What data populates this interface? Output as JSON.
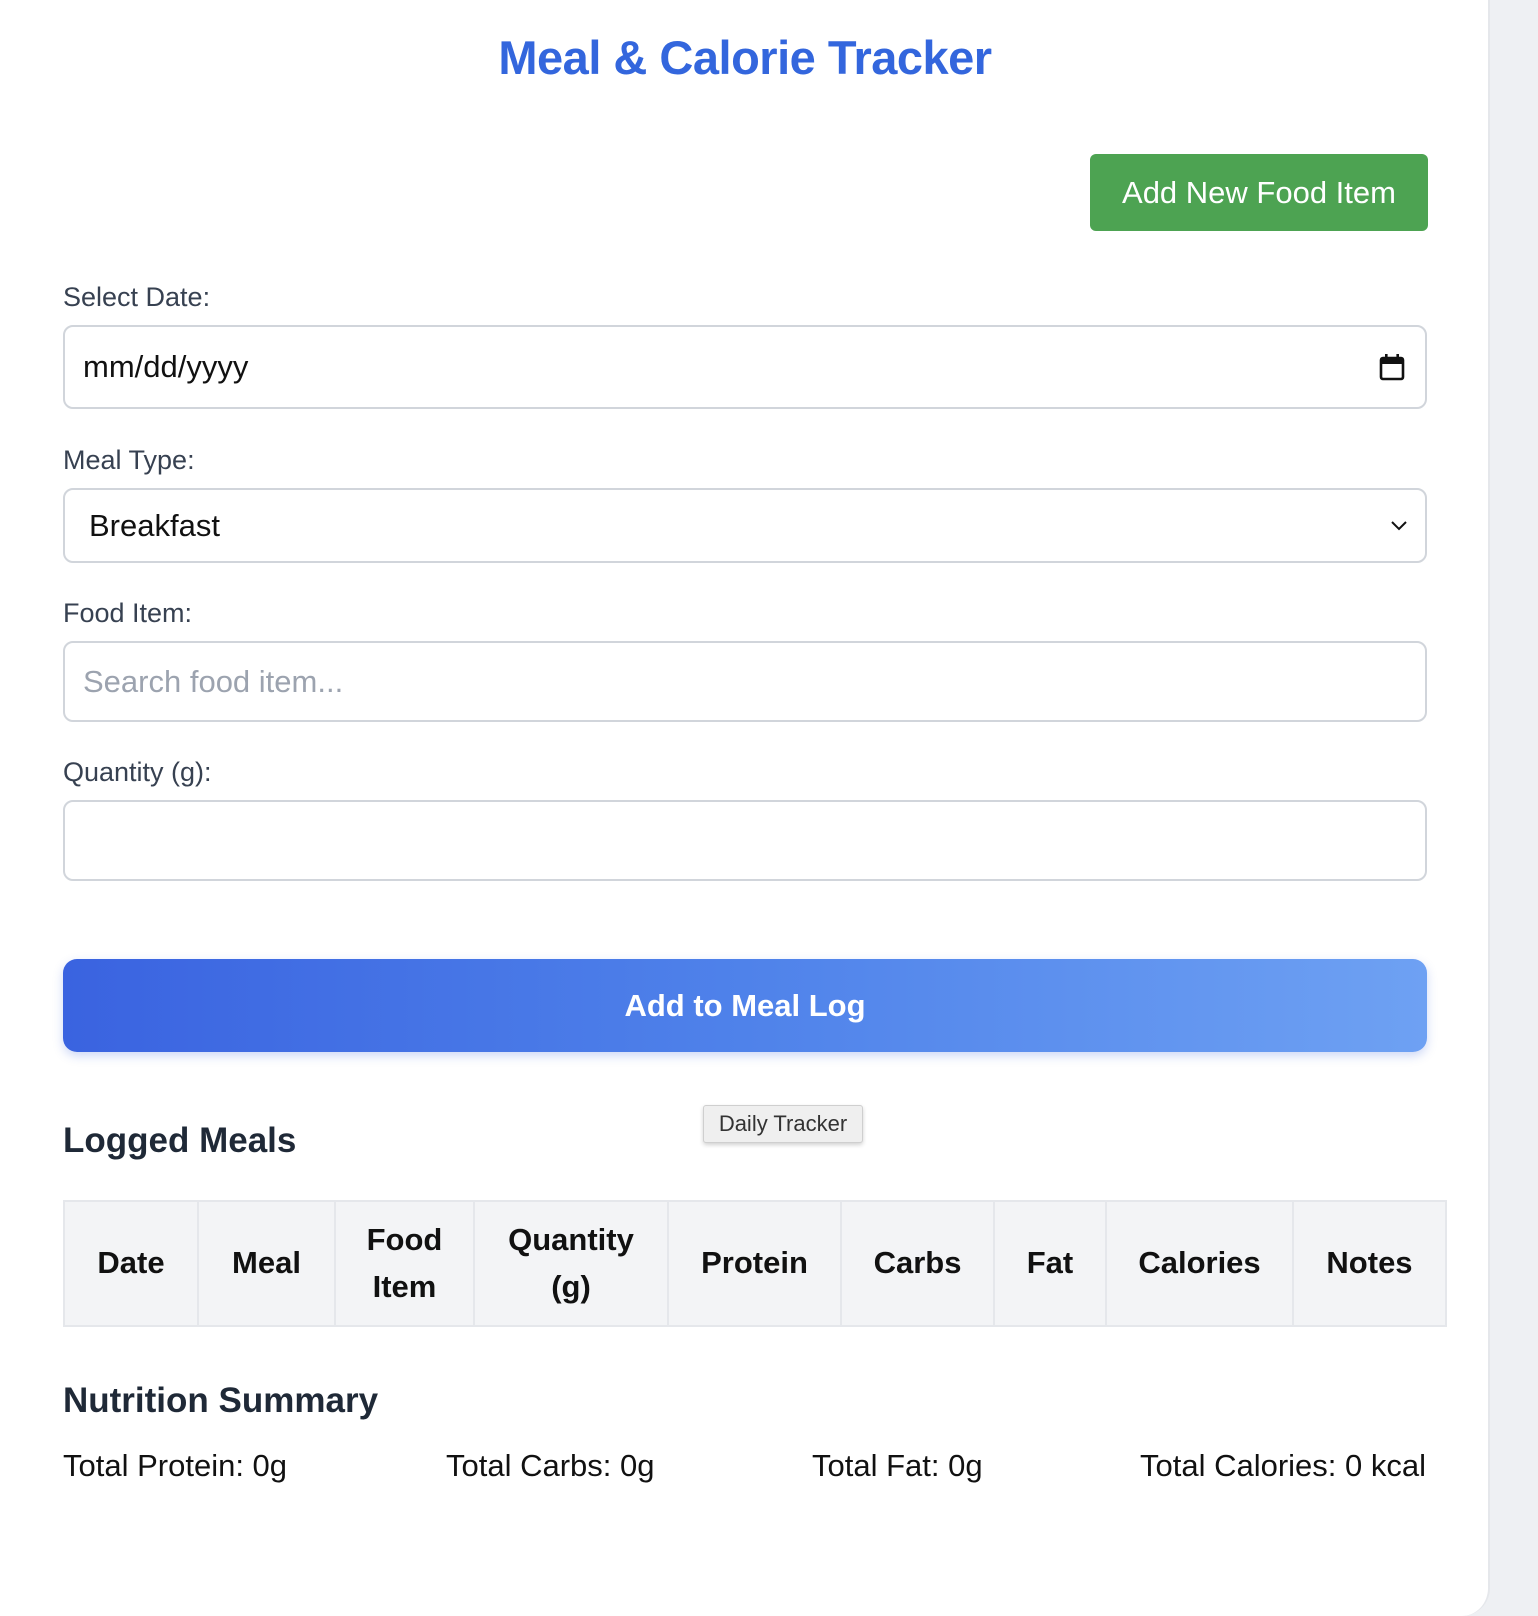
{
  "app": {
    "title": "Meal & Calorie Tracker"
  },
  "toolbar": {
    "add_food_label": "Add New Food Item"
  },
  "form": {
    "date_label": "Select Date:",
    "date_placeholder": "mm/dd/yyyy",
    "meal_type_label": "Meal Type:",
    "meal_type_selected": "Breakfast",
    "food_item_label": "Food Item:",
    "food_item_placeholder": "Search food item...",
    "food_item_value": "",
    "quantity_label": "Quantity (g):",
    "quantity_value": "",
    "submit_label": "Add to Meal Log"
  },
  "tooltip": {
    "text": "Daily Tracker"
  },
  "logged_meals": {
    "title": "Logged Meals",
    "columns": [
      "Date",
      "Meal",
      "Food Item",
      "Quantity (g)",
      "Protein",
      "Carbs",
      "Fat",
      "Calories",
      "Notes"
    ],
    "rows": []
  },
  "summary": {
    "title": "Nutrition Summary",
    "total_protein": "Total Protein: 0g",
    "total_carbs": "Total Carbs: 0g",
    "total_fat": "Total Fat: 0g",
    "total_calories": "Total Calories: 0 kcal"
  },
  "colors": {
    "title": "#3366dd",
    "add_food_button": "#4da352",
    "primary_gradient_start": "#3a63e0",
    "primary_gradient_end": "#6ea1f3"
  },
  "icons": {
    "date": "calendar-icon",
    "select": "chevron-down-icon"
  }
}
